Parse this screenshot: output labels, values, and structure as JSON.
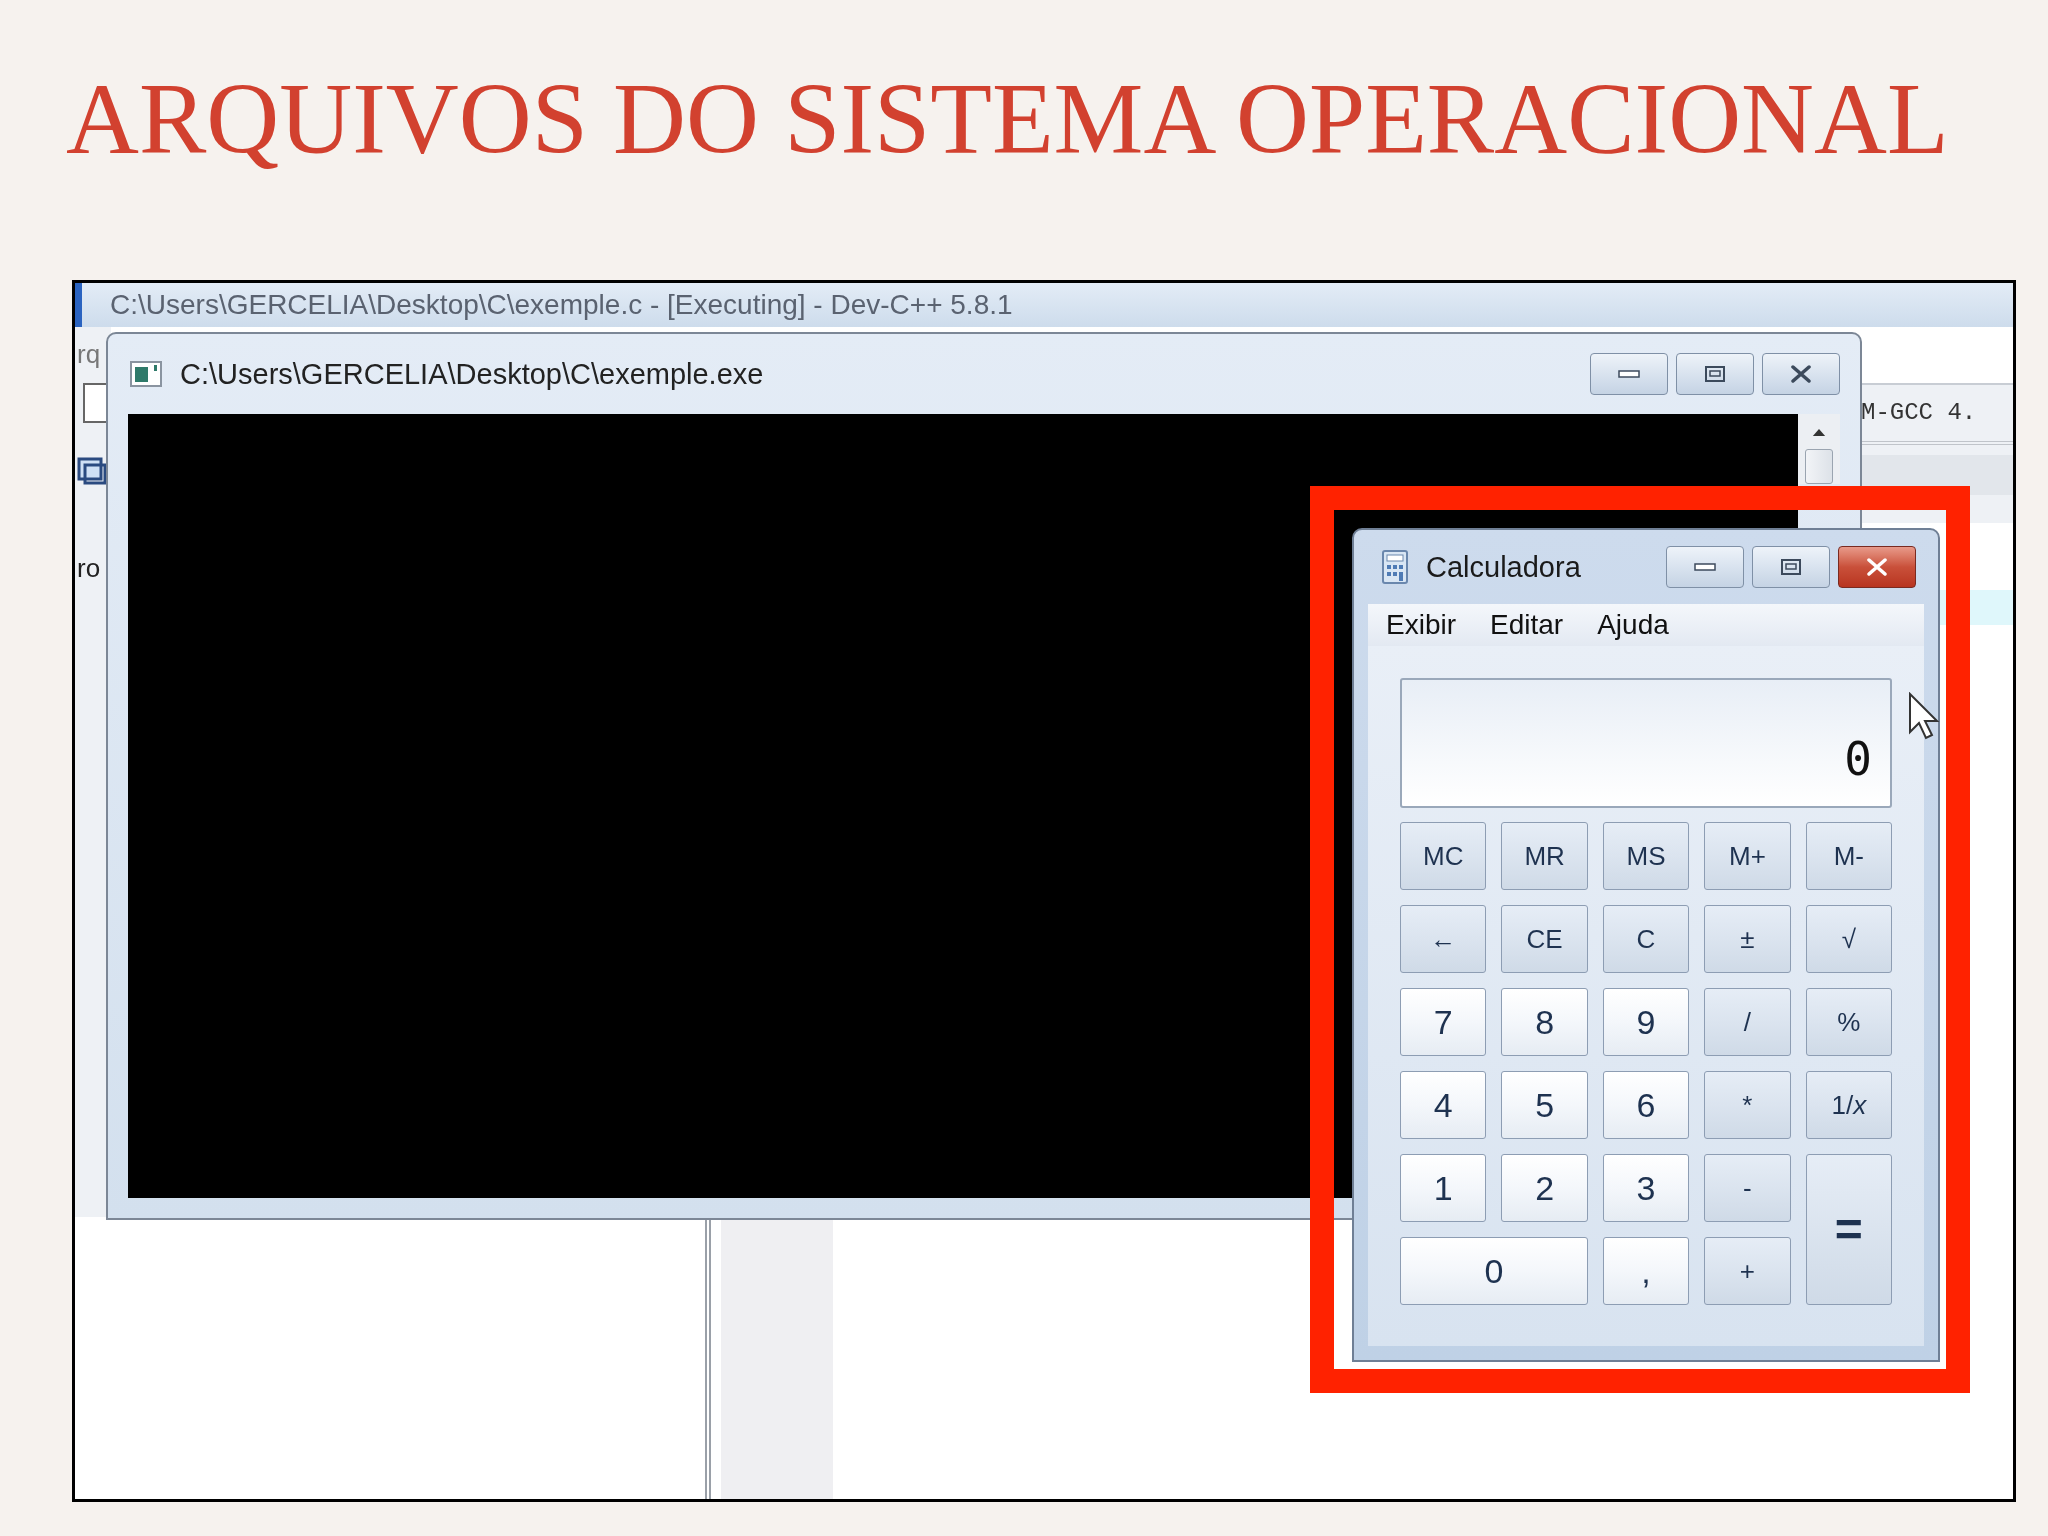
{
  "slide_title": "ARQUIVOS DO SISTEMA OPERACIONAL",
  "ide_window": {
    "title": "C:\\Users\\GERCELIA\\Desktop\\C\\exemple.c - [Executing] - Dev-C++ 5.8.1",
    "left_texts": [
      "rq",
      "ro"
    ],
    "compiler_text": "M-GCC 4."
  },
  "console_window": {
    "title": "C:\\Users\\GERCELIA\\Desktop\\C\\exemple.exe"
  },
  "calculator": {
    "title": "Calculadora",
    "menu": [
      "Exibir",
      "Editar",
      "Ajuda"
    ],
    "display": "0",
    "keys": [
      {
        "label": "MC",
        "kind": "control"
      },
      {
        "label": "MR",
        "kind": "control"
      },
      {
        "label": "MS",
        "kind": "control"
      },
      {
        "label": "M+",
        "kind": "control"
      },
      {
        "label": "M-",
        "kind": "control"
      },
      {
        "label": "←",
        "kind": "control"
      },
      {
        "label": "CE",
        "kind": "control"
      },
      {
        "label": "C",
        "kind": "control"
      },
      {
        "label": "±",
        "kind": "control"
      },
      {
        "label": "√",
        "kind": "control"
      },
      {
        "label": "7",
        "kind": "digit"
      },
      {
        "label": "8",
        "kind": "digit"
      },
      {
        "label": "9",
        "kind": "digit"
      },
      {
        "label": "/",
        "kind": "control"
      },
      {
        "label": "%",
        "kind": "control"
      },
      {
        "label": "4",
        "kind": "digit"
      },
      {
        "label": "5",
        "kind": "digit"
      },
      {
        "label": "6",
        "kind": "digit"
      },
      {
        "label": "*",
        "kind": "control"
      },
      {
        "label": "1/*x*",
        "kind": "control"
      },
      {
        "label": "1",
        "kind": "digit"
      },
      {
        "label": "2",
        "kind": "digit"
      },
      {
        "label": "3",
        "kind": "digit"
      },
      {
        "label": "-",
        "kind": "control"
      },
      {
        "label": "=",
        "kind": "equals"
      },
      {
        "label": "0",
        "kind": "zero"
      },
      {
        "label": ",",
        "kind": "digit"
      },
      {
        "label": "+",
        "kind": "control"
      }
    ]
  }
}
